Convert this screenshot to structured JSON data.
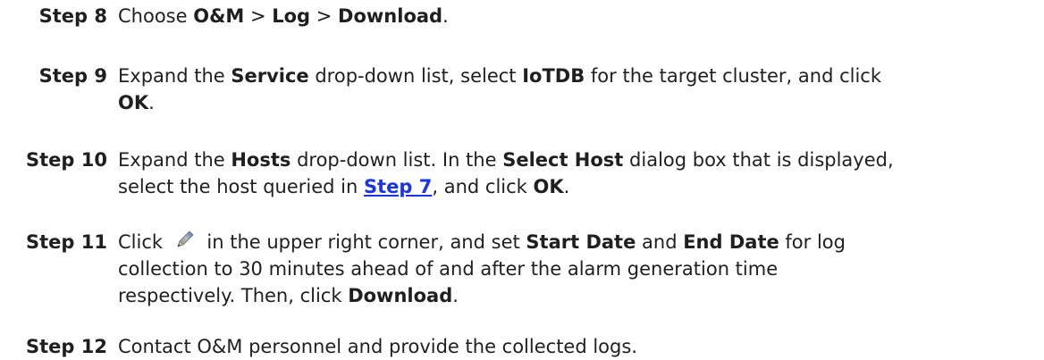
{
  "steps": [
    {
      "label": "Step 8",
      "lines": [
        [
          {
            "t": "Choose "
          },
          {
            "t": "O&M",
            "b": true
          },
          {
            "t": " > "
          },
          {
            "t": "Log",
            "b": true
          },
          {
            "t": " > "
          },
          {
            "t": "Download",
            "b": true
          },
          {
            "t": "."
          }
        ]
      ]
    },
    {
      "label": "Step 9",
      "lines": [
        [
          {
            "t": "Expand the "
          },
          {
            "t": "Service",
            "b": true
          },
          {
            "t": " drop-down list, select "
          },
          {
            "t": "IoTDB",
            "b": true
          },
          {
            "t": " for the target cluster, and click"
          }
        ],
        [
          {
            "t": "OK",
            "b": true
          },
          {
            "t": "."
          }
        ]
      ]
    },
    {
      "label": "Step 10",
      "lines": [
        [
          {
            "t": "Expand the "
          },
          {
            "t": "Hosts",
            "b": true
          },
          {
            "t": " drop-down list. In the "
          },
          {
            "t": "Select Host",
            "b": true
          },
          {
            "t": " dialog box that is displayed,"
          }
        ],
        [
          {
            "t": "select the host queried in "
          },
          {
            "t": "Step 7",
            "link": true
          },
          {
            "t": ", and click "
          },
          {
            "t": "OK",
            "b": true
          },
          {
            "t": "."
          }
        ]
      ]
    },
    {
      "label": "Step 11",
      "lines": [
        [
          {
            "t": "Click "
          },
          {
            "icon": "pencil-icon"
          },
          {
            "t": " in the upper right corner, and set "
          },
          {
            "t": "Start Date",
            "b": true
          },
          {
            "t": " and "
          },
          {
            "t": "End Date",
            "b": true
          },
          {
            "t": " for log"
          }
        ],
        [
          {
            "t": "collection to 30 minutes ahead of and after the alarm generation time"
          }
        ],
        [
          {
            "t": "respectively. Then, click "
          },
          {
            "t": "Download",
            "b": true
          },
          {
            "t": "."
          }
        ]
      ]
    },
    {
      "label": "Step 12",
      "lines": [
        [
          {
            "t": "Contact O&M personnel and provide the collected logs."
          }
        ]
      ]
    }
  ]
}
